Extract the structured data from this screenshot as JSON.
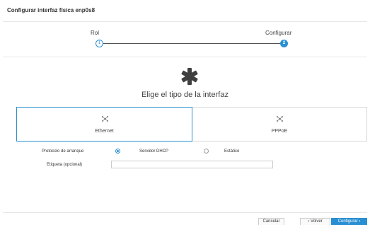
{
  "dialog": {
    "title": "Configurar interfaz física enp0s8"
  },
  "wizard": {
    "steps": [
      {
        "label": "Rol",
        "number": "1",
        "state": "done"
      },
      {
        "label": "Configurar",
        "number": "2",
        "state": "active"
      }
    ]
  },
  "main": {
    "icon": "asterisk-icon",
    "subtitle": "Elige el tipo de la interfaz",
    "types": [
      {
        "label": "Ethernet",
        "icon": "network-nodes-icon",
        "selected": true
      },
      {
        "label": "PPPoE",
        "icon": "network-nodes-icon",
        "selected": false
      }
    ]
  },
  "form": {
    "boot_protocol_label": "Protocolo de arranque",
    "options": [
      {
        "label": "Servidor DHCP",
        "checked": true
      },
      {
        "label": "Estático",
        "checked": false
      }
    ],
    "tag_label": "Etiqueta  (opcional)",
    "tag_value": ""
  },
  "footer": {
    "cancel_label": "Cancelar",
    "back_label": "‹  Volver",
    "next_label": "Configurar  ›"
  },
  "colors": {
    "accent": "#2a8fd2",
    "border": "#d8d8d8"
  }
}
